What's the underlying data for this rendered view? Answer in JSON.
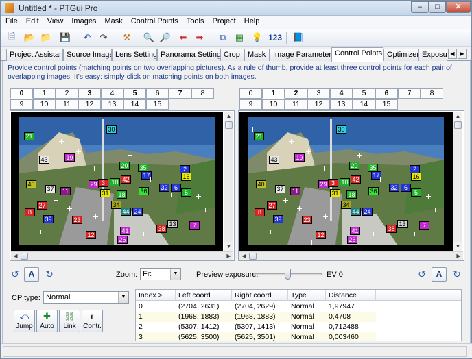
{
  "window": {
    "title": "Untitled * - PTGui Pro"
  },
  "menu": [
    "File",
    "Edit",
    "View",
    "Images",
    "Mask",
    "Control Points",
    "Tools",
    "Project",
    "Help"
  ],
  "toolbar": {
    "number_label": "123"
  },
  "tabs": [
    "Project Assistant",
    "Source Images",
    "Lens Settings",
    "Panorama Settings",
    "Crop",
    "Mask",
    "Image Parameters",
    "Control Points",
    "Optimizer",
    "Exposure"
  ],
  "active_tab": "Control Points",
  "info_text": "Provide control points (matching points on two overlapping pictures). As a rule of thumb, provide at least three control points for each pair of overlapping images. It's easy: simply click on matching points on both images.",
  "left_tabs_row1": [
    "0",
    "1",
    "2",
    "3",
    "4",
    "5",
    "6",
    "7",
    "8"
  ],
  "left_tabs_row2": [
    "9",
    "10",
    "11",
    "12",
    "13",
    "14",
    "15"
  ],
  "right_tabs_row1": [
    "0",
    "1",
    "2",
    "3",
    "4",
    "5",
    "6",
    "7",
    "8"
  ],
  "right_tabs_row2": [
    "9",
    "10",
    "11",
    "12",
    "13",
    "14",
    "15"
  ],
  "left_selected": "0",
  "right_selected": "1",
  "zoom": {
    "label": "Zoom:",
    "value": "Fit"
  },
  "preview_exposure": {
    "label": "Preview exposure:",
    "value_text": "EV 0",
    "level": 0.5
  },
  "auto_button": {
    "label": "A"
  },
  "cp_type": {
    "label": "CP type:",
    "value": "Normal"
  },
  "action_buttons": [
    {
      "label": "Jump",
      "icon": "jump-icon"
    },
    {
      "label": "Auto",
      "icon": "auto-icon"
    },
    {
      "label": "Link",
      "icon": "link-icon"
    },
    {
      "label": "Contr.",
      "icon": "contrast-icon"
    }
  ],
  "table": {
    "columns": [
      "Index >",
      "Left coord",
      "Right coord",
      "Type",
      "Distance"
    ],
    "rows": [
      {
        "index": "0",
        "left": "(2704, 2631)",
        "right": "(2704, 2629)",
        "type": "Normal",
        "distance": "1,97947"
      },
      {
        "index": "1",
        "left": "(1968, 1883)",
        "right": "(1968, 1883)",
        "type": "Normal",
        "distance": "0,4708"
      },
      {
        "index": "2",
        "left": "(5307, 1412)",
        "right": "(5307, 1413)",
        "type": "Normal",
        "distance": "0,712488"
      },
      {
        "index": "3",
        "left": "(5625, 3500)",
        "right": "(5625, 3501)",
        "type": "Normal",
        "distance": "0,003460"
      }
    ]
  },
  "control_points_left": [
    {
      "n": "30",
      "c": "#2ad4e0"
    },
    {
      "n": "21",
      "c": "#1fb32a"
    },
    {
      "n": "43",
      "c": "#e8e8e8"
    },
    {
      "n": "19",
      "c": "#c02ad0"
    },
    {
      "n": "20",
      "c": "#1fb32a"
    },
    {
      "n": "35",
      "c": "#1fb32a"
    },
    {
      "n": "2",
      "c": "#2436d8"
    },
    {
      "n": "17",
      "c": "#2436d8"
    },
    {
      "n": "16",
      "c": "#e8e800"
    },
    {
      "n": "42",
      "c": "#d82424"
    },
    {
      "n": "10",
      "c": "#1fb32a"
    },
    {
      "n": "40",
      "c": "#c0c020"
    },
    {
      "n": "37",
      "c": "#e8e8e8"
    },
    {
      "n": "11",
      "c": "#8a1a8a"
    },
    {
      "n": "29",
      "c": "#c02ad0"
    },
    {
      "n": "3",
      "c": "#d82424"
    },
    {
      "n": "36",
      "c": "#36e036"
    },
    {
      "n": "32",
      "c": "#2436d8"
    },
    {
      "n": "6",
      "c": "#2436d8"
    },
    {
      "n": "5",
      "c": "#1fb32a"
    },
    {
      "n": "31",
      "c": "#e8e800"
    },
    {
      "n": "18",
      "c": "#1fb32a"
    },
    {
      "n": "34",
      "c": "#a5a520"
    },
    {
      "n": "27",
      "c": "#d82424"
    },
    {
      "n": "8",
      "c": "#d82424"
    },
    {
      "n": "44",
      "c": "#1f7f7f"
    },
    {
      "n": "24",
      "c": "#2436d8"
    },
    {
      "n": "39",
      "c": "#2436d8"
    },
    {
      "n": "23",
      "c": "#d82424"
    },
    {
      "n": "13",
      "c": "#d0d0d0"
    },
    {
      "n": "7",
      "c": "#c02ad0"
    },
    {
      "n": "41",
      "c": "#c02ad0"
    },
    {
      "n": "38",
      "c": "#d82424"
    },
    {
      "n": "12",
      "c": "#d82424"
    },
    {
      "n": "26",
      "c": "#c02ad0"
    }
  ]
}
